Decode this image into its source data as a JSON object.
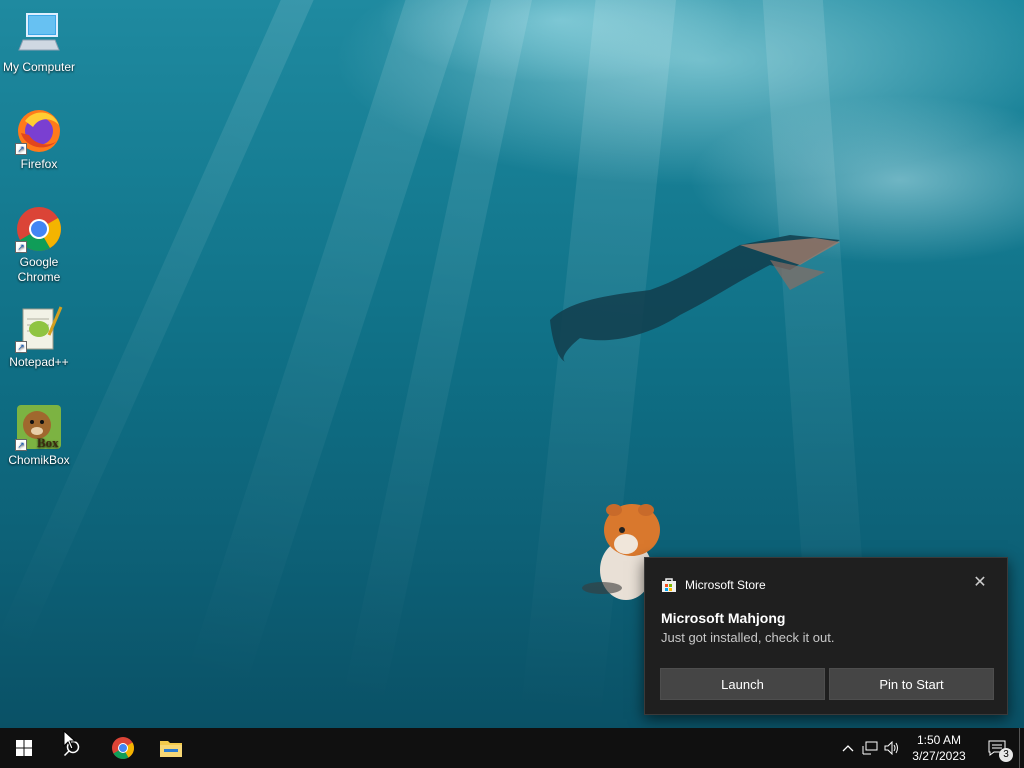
{
  "desktop": {
    "icons": [
      {
        "label": "My Computer",
        "icon": "computer-icon"
      },
      {
        "label": "Firefox",
        "icon": "firefox-icon"
      },
      {
        "label": "Google Chrome",
        "icon": "chrome-icon"
      },
      {
        "label": "Notepad++",
        "icon": "notepadpp-icon"
      },
      {
        "label": "ChomikBox",
        "icon": "chomikbox-icon"
      }
    ]
  },
  "toast": {
    "app_name": "Microsoft Store",
    "title": "Microsoft Mahjong",
    "body": "Just got installed, check it out.",
    "launch_label": "Launch",
    "pin_label": "Pin to Start",
    "close_glyph": "✕"
  },
  "taskbar": {
    "start_icon": "windows-logo-icon",
    "search_icon": "search-icon",
    "pinned": [
      "chrome-icon",
      "file-explorer-icon"
    ],
    "tray": {
      "chevron_glyph": "^",
      "time": "1:50 AM",
      "date": "3/27/2023",
      "notification_count": "3"
    }
  },
  "colors": {
    "toast_bg": "#1f1f1f",
    "button_bg": "#454545",
    "taskbar_bg": "#101010"
  }
}
